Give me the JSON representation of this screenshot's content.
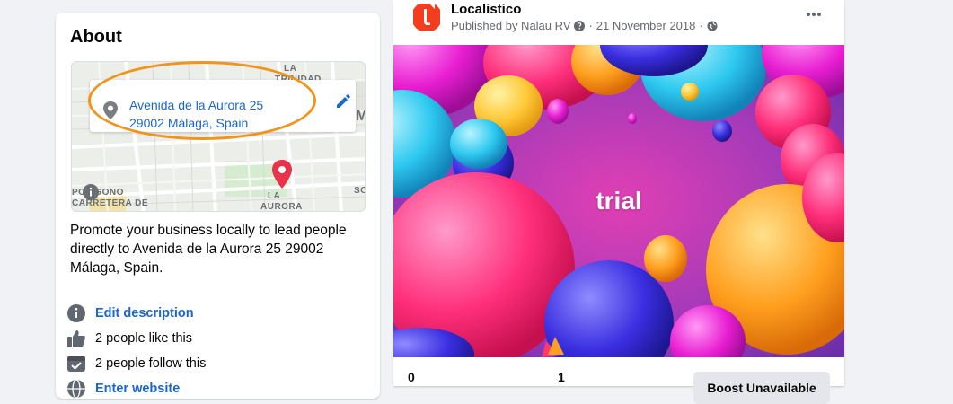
{
  "about": {
    "title": "About",
    "map": {
      "address_line1": "Avenida de la Aurora 25",
      "address_line2": "29002 Málaga, Spain",
      "labels": [
        "LA",
        "TRINIDAD",
        "M",
        "MARMOLES",
        "POLIGONO",
        "CARRETERA DE",
        "LA",
        "AURORA",
        "SO"
      ]
    },
    "description": "Promote your business locally to lead people directly to Avenida de la Aurora 25 29002 Málaga, Spain.",
    "rows": {
      "edit_description": "Edit description",
      "likes": "2 people like this",
      "follows": "2 people follow this",
      "website": "Enter website"
    }
  },
  "post": {
    "page_name": "Localistico",
    "published_by": "Published by Nalau RV",
    "date": "21 November 2018",
    "separator": "·",
    "image_text": "trial",
    "stat_left": "0",
    "stat_mid": "1",
    "boost_button": "Boost Unavailable"
  },
  "colors": {
    "link_blue": "#1a66c9",
    "highlight_orange": "#f0941b",
    "logo_red": "#f23d1e",
    "marker_red": "#e8334a"
  }
}
